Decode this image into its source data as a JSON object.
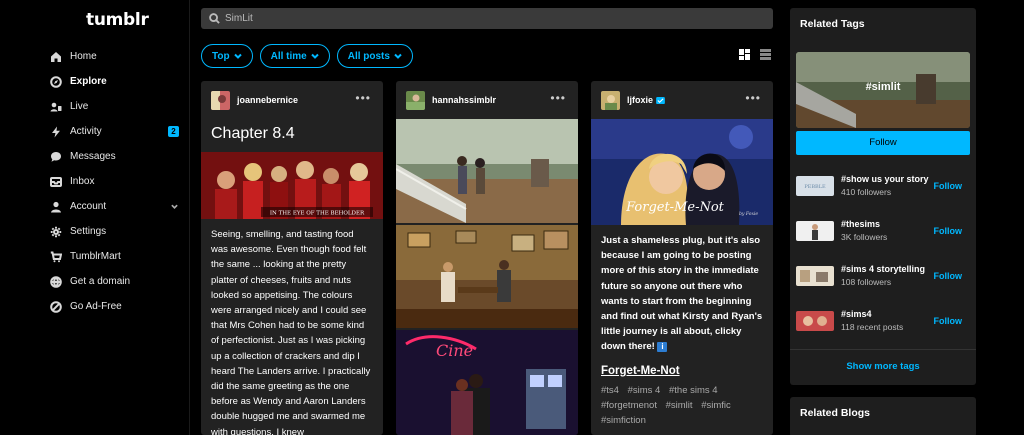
{
  "app": {
    "logo": "tumblr"
  },
  "nav": {
    "items": [
      {
        "label": "Home",
        "icon": "home-icon"
      },
      {
        "label": "Explore",
        "icon": "compass-icon"
      },
      {
        "label": "Live",
        "icon": "live-icon"
      },
      {
        "label": "Activity",
        "icon": "bolt-icon",
        "badge": "2"
      },
      {
        "label": "Messages",
        "icon": "chat-icon"
      },
      {
        "label": "Inbox",
        "icon": "inbox-icon"
      },
      {
        "label": "Account",
        "icon": "person-icon"
      },
      {
        "label": "Settings",
        "icon": "gear-icon"
      },
      {
        "label": "TumblrMart",
        "icon": "cart-icon"
      },
      {
        "label": "Get a domain",
        "icon": "globe-icon"
      },
      {
        "label": "Go Ad-Free",
        "icon": "ad-free-icon"
      }
    ]
  },
  "search": {
    "value": "SimLit"
  },
  "filters": {
    "sort": "Top",
    "time": "All time",
    "type": "All posts"
  },
  "posts": [
    {
      "username": "joannebernice",
      "title": "Chapter 8.4",
      "image_caption": "IN THE EYE OF THE BEHOLDER",
      "body": "Seeing, smelling, and tasting food was awesome. Even though food felt the same ... looking at the pretty platter of cheeses, fruits and nuts looked so appetising. The colours were arranged nicely and I could see that Mrs Cohen had to be some kind of perfectionist. Just as I was picking up a collection of crackers and dip I heard The Landers arrive. I practically did the same greeting as the one before as Wendy and Aaron Landers double hugged me and swarmed me with questions. I knew"
    },
    {
      "username": "hannahssimblr",
      "image_text": "Cine"
    },
    {
      "username": "ljfoxie",
      "image_caption": "Forget-Me-Not",
      "image_signature": "by Foxie",
      "body": "Just a shameless plug, but it's also because I am going to be posting more of this story in the immediate future so anyone out there who wants to start from the beginning and find out what Kirsty and Ryan's little journey is all about, clicky down there!",
      "info_icon": "i",
      "link": "Forget-Me-Not",
      "tags": [
        "#ts4",
        "#sims 4",
        "#the sims 4",
        "#forgetmenot",
        "#simlit",
        "#simfic",
        "#simfiction"
      ]
    }
  ],
  "related_tags": {
    "title": "Related Tags",
    "hero_tag": "#simlit",
    "follow_label": "Follow",
    "items": [
      {
        "name": "#show us your story",
        "sub": "410 followers",
        "thumb_text": "PEBBLE",
        "action": "Follow"
      },
      {
        "name": "#thesims",
        "sub": "3K followers",
        "action": "Follow"
      },
      {
        "name": "#sims 4 storytelling",
        "sub": "108 followers",
        "action": "Follow"
      },
      {
        "name": "#sims4",
        "sub": "118 recent posts",
        "action": "Follow"
      }
    ],
    "show_more": "Show more tags"
  },
  "related_blogs": {
    "title": "Related Blogs"
  },
  "colors": {
    "accent": "#00b8ff",
    "background": "#000000",
    "card": "#222222"
  }
}
